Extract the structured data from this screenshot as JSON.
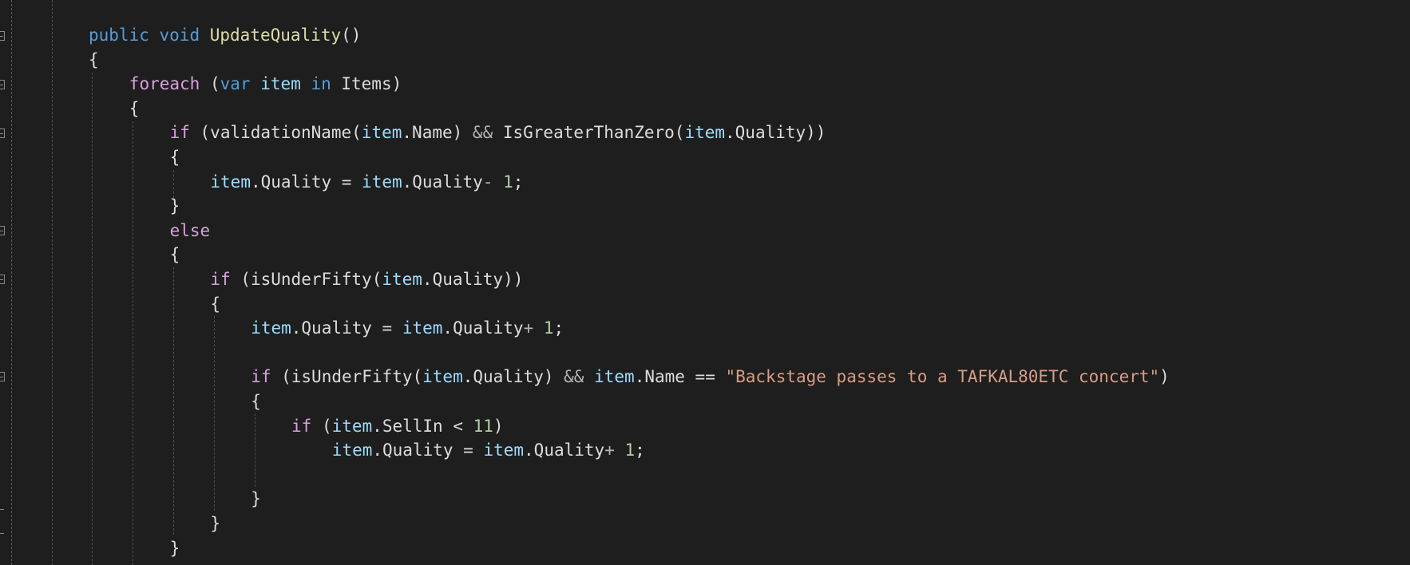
{
  "editor": {
    "lines": [
      {
        "indent": 0,
        "tokens": [
          [
            "kw",
            "public"
          ],
          [
            "txt",
            " "
          ],
          [
            "kw",
            "void"
          ],
          [
            "txt",
            " "
          ],
          [
            "fn",
            "UpdateQuality"
          ],
          [
            "txt",
            "()"
          ]
        ]
      },
      {
        "indent": 0,
        "tokens": [
          [
            "txt",
            "{"
          ]
        ]
      },
      {
        "indent": 1,
        "tokens": [
          [
            "ctl",
            "foreach"
          ],
          [
            "txt",
            " ("
          ],
          [
            "kw",
            "var"
          ],
          [
            "txt",
            " "
          ],
          [
            "var",
            "item"
          ],
          [
            "txt",
            " "
          ],
          [
            "kw",
            "in"
          ],
          [
            "txt",
            " Items)"
          ]
        ]
      },
      {
        "indent": 1,
        "tokens": [
          [
            "txt",
            "{"
          ]
        ]
      },
      {
        "indent": 2,
        "tokens": [
          [
            "ctl",
            "if"
          ],
          [
            "txt",
            " (validationName("
          ],
          [
            "var",
            "item"
          ],
          [
            "txt",
            ".Name) "
          ],
          [
            "op",
            "&&"
          ],
          [
            "txt",
            " IsGreaterThanZero("
          ],
          [
            "var",
            "item"
          ],
          [
            "txt",
            ".Quality))"
          ]
        ]
      },
      {
        "indent": 2,
        "tokens": [
          [
            "txt",
            "{"
          ]
        ]
      },
      {
        "indent": 3,
        "tokens": [
          [
            "var",
            "item"
          ],
          [
            "txt",
            ".Quality = "
          ],
          [
            "var",
            "item"
          ],
          [
            "txt",
            ".Quality"
          ],
          [
            "op",
            "-"
          ],
          [
            "txt",
            " "
          ],
          [
            "num",
            "1"
          ],
          [
            "txt",
            ";"
          ]
        ]
      },
      {
        "indent": 2,
        "tokens": [
          [
            "txt",
            "}"
          ]
        ]
      },
      {
        "indent": 2,
        "tokens": [
          [
            "ctl",
            "else"
          ]
        ]
      },
      {
        "indent": 2,
        "tokens": [
          [
            "txt",
            "{"
          ]
        ]
      },
      {
        "indent": 3,
        "tokens": [
          [
            "ctl",
            "if"
          ],
          [
            "txt",
            " (isUnderFifty("
          ],
          [
            "var",
            "item"
          ],
          [
            "txt",
            ".Quality))"
          ]
        ]
      },
      {
        "indent": 3,
        "tokens": [
          [
            "txt",
            "{"
          ]
        ]
      },
      {
        "indent": 4,
        "tokens": [
          [
            "var",
            "item"
          ],
          [
            "txt",
            ".Quality = "
          ],
          [
            "var",
            "item"
          ],
          [
            "txt",
            ".Quality"
          ],
          [
            "op",
            "+"
          ],
          [
            "txt",
            " "
          ],
          [
            "num",
            "1"
          ],
          [
            "txt",
            ";"
          ]
        ]
      },
      {
        "indent": 4,
        "tokens": []
      },
      {
        "indent": 4,
        "tokens": [
          [
            "ctl",
            "if"
          ],
          [
            "txt",
            " (isUnderFifty("
          ],
          [
            "var",
            "item"
          ],
          [
            "txt",
            ".Quality) "
          ],
          [
            "op",
            "&&"
          ],
          [
            "txt",
            " "
          ],
          [
            "var",
            "item"
          ],
          [
            "txt",
            ".Name == "
          ],
          [
            "str",
            "\"Backstage passes to a TAFKAL80ETC concert\""
          ],
          [
            "txt",
            ")"
          ]
        ]
      },
      {
        "indent": 4,
        "tokens": [
          [
            "txt",
            "{"
          ]
        ]
      },
      {
        "indent": 5,
        "tokens": [
          [
            "ctl",
            "if"
          ],
          [
            "txt",
            " ("
          ],
          [
            "var",
            "item"
          ],
          [
            "txt",
            ".SellIn < "
          ],
          [
            "num",
            "11"
          ],
          [
            "txt",
            ")"
          ]
        ]
      },
      {
        "indent": 6,
        "tokens": [
          [
            "var",
            "item"
          ],
          [
            "txt",
            ".Quality = "
          ],
          [
            "var",
            "item"
          ],
          [
            "txt",
            ".Quality"
          ],
          [
            "op",
            "+"
          ],
          [
            "txt",
            " "
          ],
          [
            "num",
            "1"
          ],
          [
            "txt",
            ";"
          ]
        ]
      },
      {
        "indent": 5,
        "tokens": []
      },
      {
        "indent": 4,
        "tokens": [
          [
            "txt",
            "}"
          ]
        ]
      },
      {
        "indent": 3,
        "tokens": [
          [
            "txt",
            "}"
          ]
        ]
      },
      {
        "indent": 2,
        "tokens": [
          [
            "txt",
            "}"
          ]
        ]
      }
    ]
  }
}
